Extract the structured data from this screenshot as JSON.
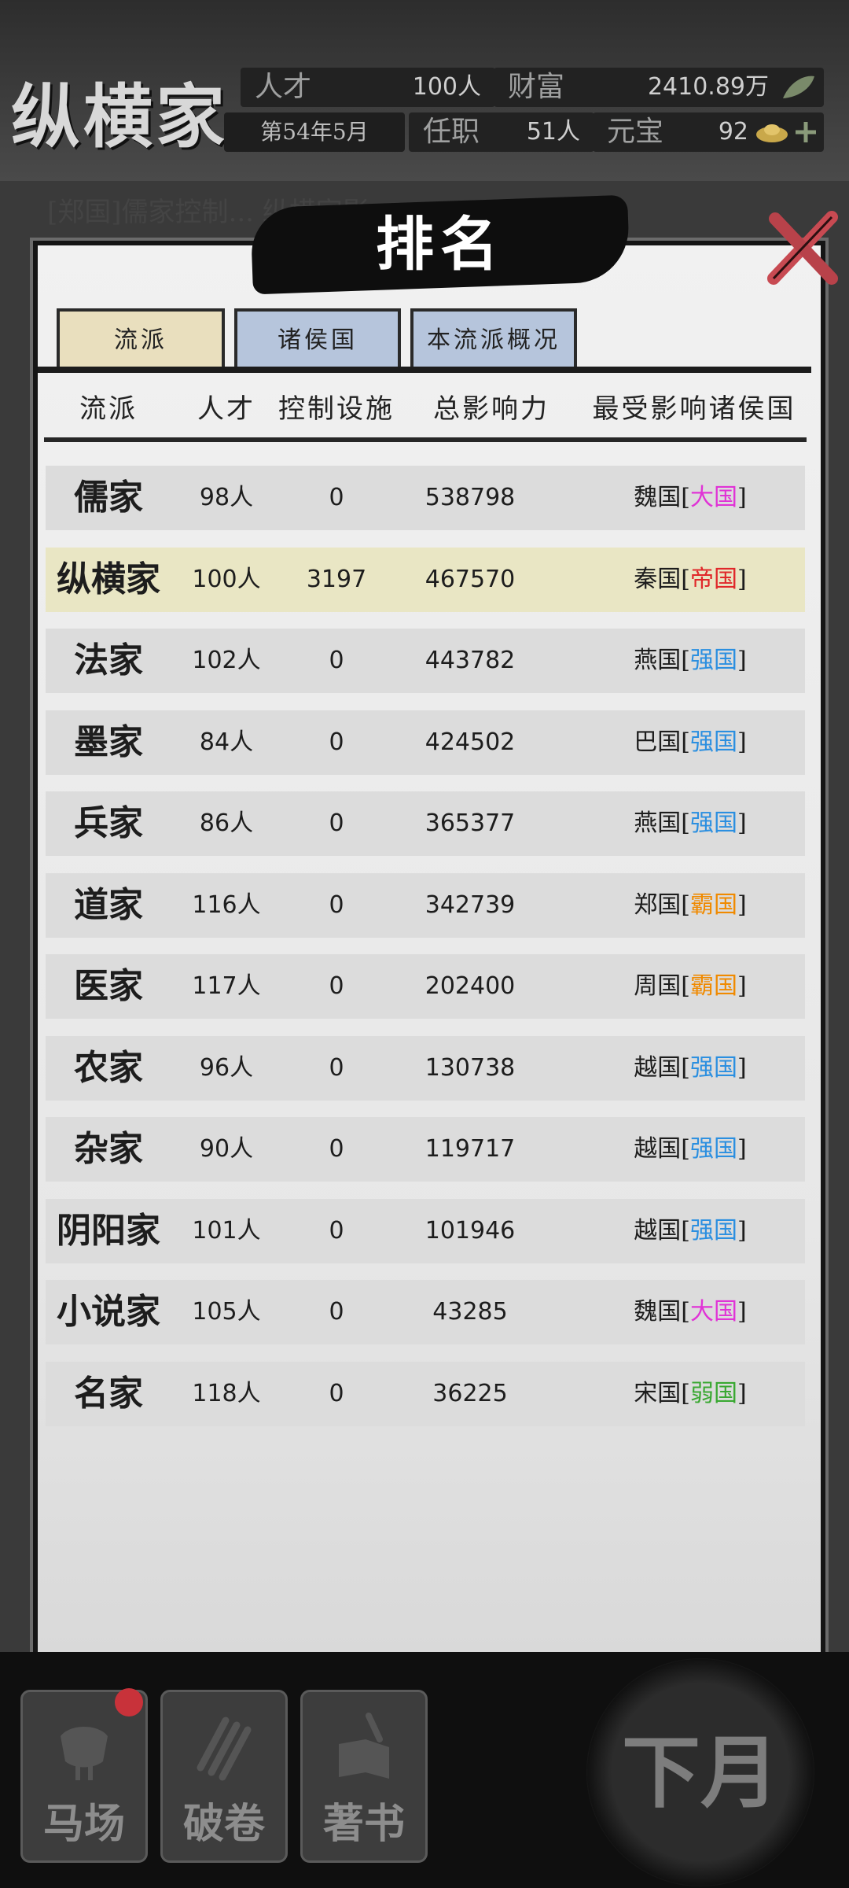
{
  "hud": {
    "faction": "纵横家",
    "talent_label": "人才",
    "talent_value": "100人",
    "wealth_label": "财富",
    "wealth_value": "2410.89万",
    "date": "第54年5月",
    "office_label": "任职",
    "office_value": "51人",
    "ingot_label": "元宝",
    "ingot_value": "92"
  },
  "notice": "[郑国]儒家控制... 纵横家影",
  "panel": {
    "title": "排名",
    "tabs": [
      "流派",
      "诸侯国",
      "本流派概况"
    ],
    "headers": [
      "流派",
      "人才",
      "控制设施",
      "总影响力",
      "最受影响诸侯国"
    ]
  },
  "rows": [
    {
      "name": "儒家",
      "talent": "98人",
      "control": "0",
      "influence": "538798",
      "state": "魏国",
      "rank": "大国",
      "color": "#e033d6"
    },
    {
      "name": "纵横家",
      "talent": "100人",
      "control": "3197",
      "influence": "467570",
      "state": "秦国",
      "rank": "帝国",
      "color": "#e0282a"
    },
    {
      "name": "法家",
      "talent": "102人",
      "control": "0",
      "influence": "443782",
      "state": "燕国",
      "rank": "强国",
      "color": "#2b8fe0"
    },
    {
      "name": "墨家",
      "talent": "84人",
      "control": "0",
      "influence": "424502",
      "state": "巴国",
      "rank": "强国",
      "color": "#2b8fe0"
    },
    {
      "name": "兵家",
      "talent": "86人",
      "control": "0",
      "influence": "365377",
      "state": "燕国",
      "rank": "强国",
      "color": "#2b8fe0"
    },
    {
      "name": "道家",
      "talent": "116人",
      "control": "0",
      "influence": "342739",
      "state": "郑国",
      "rank": "霸国",
      "color": "#f08a00"
    },
    {
      "name": "医家",
      "talent": "117人",
      "control": "0",
      "influence": "202400",
      "state": "周国",
      "rank": "霸国",
      "color": "#f08a00"
    },
    {
      "name": "农家",
      "talent": "96人",
      "control": "0",
      "influence": "130738",
      "state": "越国",
      "rank": "强国",
      "color": "#2b8fe0"
    },
    {
      "name": "杂家",
      "talent": "90人",
      "control": "0",
      "influence": "119717",
      "state": "越国",
      "rank": "强国",
      "color": "#2b8fe0"
    },
    {
      "name": "阴阳家",
      "talent": "101人",
      "control": "0",
      "influence": "101946",
      "state": "越国",
      "rank": "强国",
      "color": "#2b8fe0"
    },
    {
      "name": "小说家",
      "talent": "105人",
      "control": "0",
      "influence": "43285",
      "state": "魏国",
      "rank": "大国",
      "color": "#e033d6"
    },
    {
      "name": "名家",
      "talent": "118人",
      "control": "0",
      "influence": "36225",
      "state": "宋国",
      "rank": "弱国",
      "color": "#3aa832"
    }
  ],
  "bottom": {
    "buttons": [
      "马场",
      "破卷",
      "著书"
    ],
    "next": "下月"
  },
  "colors": {
    "highlight_row": "#e9e6c4",
    "active_tab": "#e9dfbe",
    "inactive_tab": "#b6c5dc"
  }
}
